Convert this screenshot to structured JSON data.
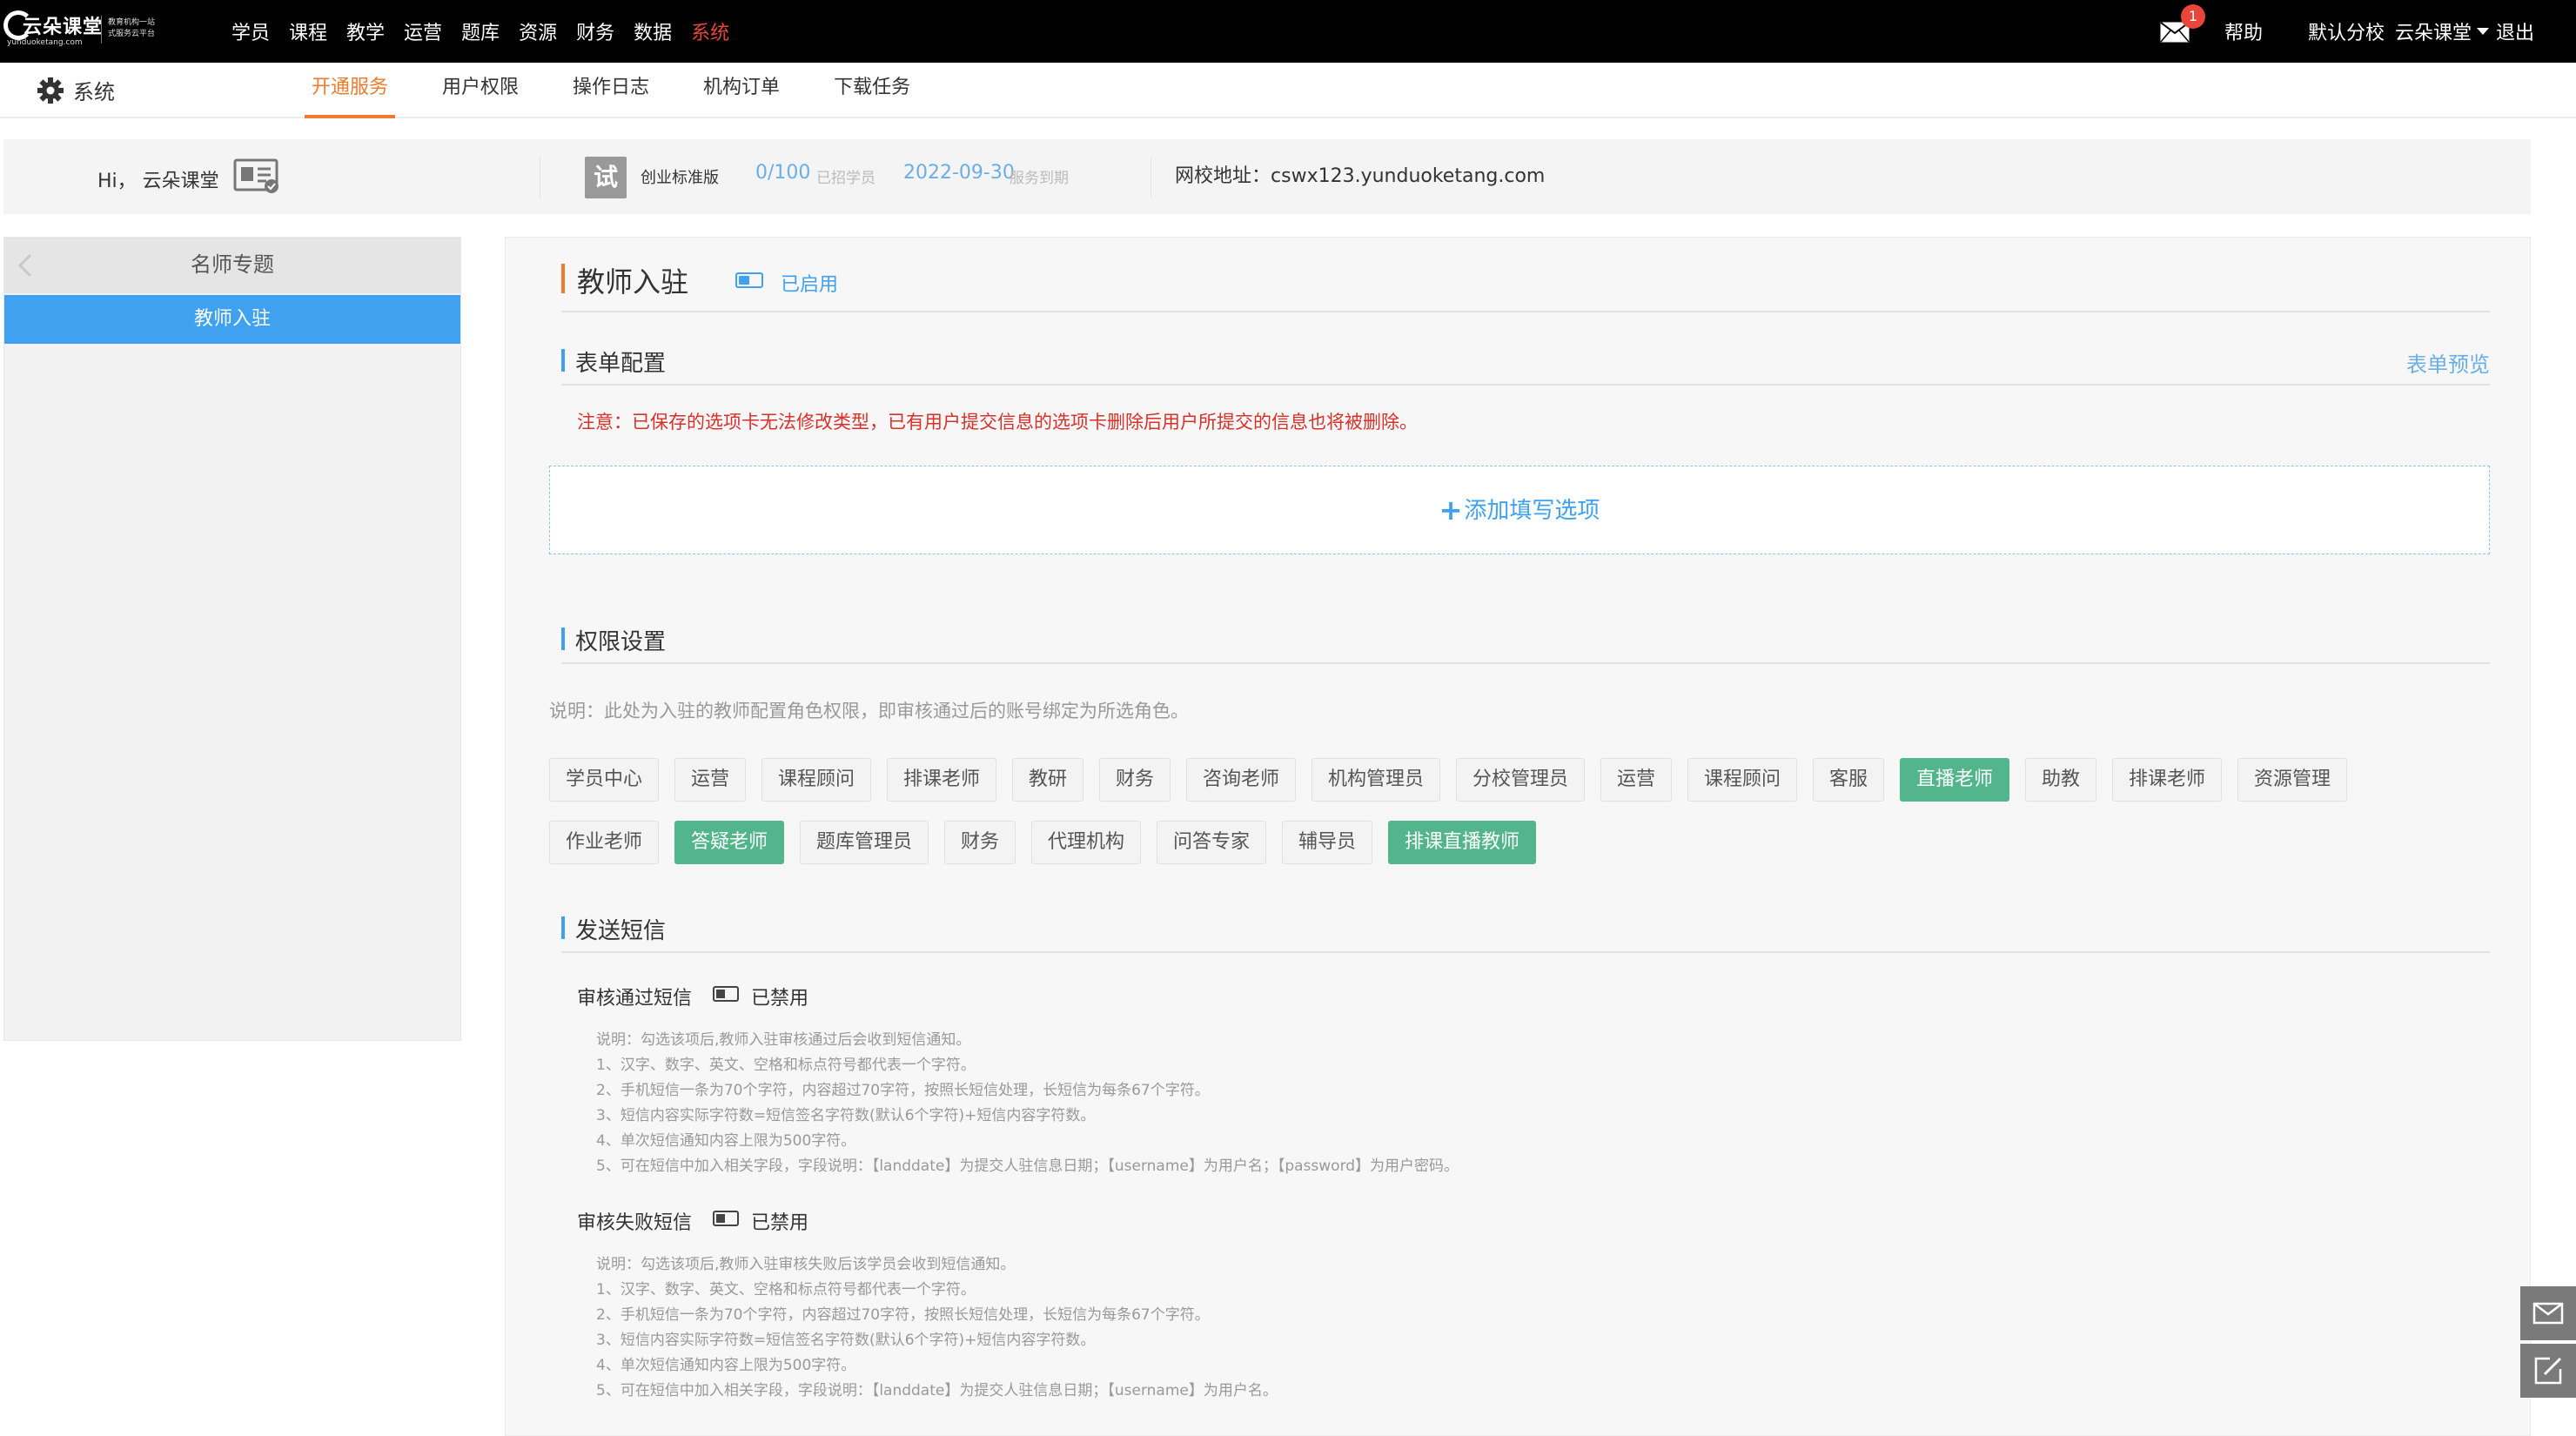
{
  "logo": {
    "name": "云朵课堂",
    "domain": "yunduoketang.com",
    "tagline1": "教育机构一站",
    "tagline2": "式服务云平台"
  },
  "nav": {
    "items": [
      "学员",
      "课程",
      "教学",
      "运营",
      "题库",
      "资源",
      "财务",
      "数据",
      "系统"
    ],
    "active_index": 8
  },
  "topright": {
    "mail_count": "1",
    "help": "帮助",
    "school": "默认分校",
    "user": "云朵课堂",
    "logout": "退出"
  },
  "subnav": {
    "section": "系统",
    "tabs": [
      "开通服务",
      "用户权限",
      "操作日志",
      "机构订单",
      "下载任务"
    ],
    "active_index": 0
  },
  "info": {
    "greeting": "Hi， 云朵课堂",
    "trial_badge": "试",
    "edition": "创业标准版",
    "students_value": "0/100",
    "students_caption": "已招学员",
    "expire_value": "2022-09-30",
    "expire_caption": "服务到期",
    "site_label": "网校地址：",
    "site_url": "cswx123.yunduoketang.com"
  },
  "left": {
    "header": "名师专题",
    "items": [
      "教师入驻"
    ]
  },
  "main": {
    "title": "教师入驻",
    "status": "已启用",
    "form_section": {
      "title": "表单配置",
      "preview_link": "表单预览",
      "notice": "注意：已保存的选项卡无法修改类型，已有用户提交信息的选项卡删除后用户所提交的信息也将被删除。",
      "add_option": "添加填写选项"
    },
    "perm_section": {
      "title": "权限设置",
      "description": "说明：此处为入驻的教师配置角色权限，即审核通过后的账号绑定为所选角色。",
      "roles": [
        {
          "label": "学员中心",
          "selected": false
        },
        {
          "label": "运营",
          "selected": false
        },
        {
          "label": "课程顾问",
          "selected": false
        },
        {
          "label": "排课老师",
          "selected": false
        },
        {
          "label": "教研",
          "selected": false
        },
        {
          "label": "财务",
          "selected": false
        },
        {
          "label": "咨询老师",
          "selected": false
        },
        {
          "label": "机构管理员",
          "selected": false
        },
        {
          "label": "分校管理员",
          "selected": false
        },
        {
          "label": "运营",
          "selected": false
        },
        {
          "label": "课程顾问",
          "selected": false
        },
        {
          "label": "客服",
          "selected": false
        },
        {
          "label": "直播老师",
          "selected": true
        },
        {
          "label": "助教",
          "selected": false
        },
        {
          "label": "排课老师",
          "selected": false
        },
        {
          "label": "资源管理",
          "selected": false
        },
        {
          "label": "作业老师",
          "selected": false
        },
        {
          "label": "答疑老师",
          "selected": true
        },
        {
          "label": "题库管理员",
          "selected": false
        },
        {
          "label": "财务",
          "selected": false
        },
        {
          "label": "代理机构",
          "selected": false
        },
        {
          "label": "问答专家",
          "selected": false
        },
        {
          "label": "辅导员",
          "selected": false
        },
        {
          "label": "排课直播教师",
          "selected": true
        }
      ]
    },
    "sms_section": {
      "title": "发送短信",
      "pass": {
        "label": "审核通过短信",
        "state": "已禁用",
        "notes": [
          "说明：勾选该项后,教师入驻审核通过后会收到短信通知。",
          "1、汉字、数字、英文、空格和标点符号都代表一个字符。",
          "2、手机短信一条为70个字符，内容超过70字符，按照长短信处理，长短信为每条67个字符。",
          "3、短信内容实际字符数=短信签名字符数(默认6个字符)+短信内容字符数。",
          "4、单次短信通知内容上限为500字符。",
          "5、可在短信中加入相关字段，字段说明：【landdate】为提交人驻信息日期；【username】为用户名；【password】为用户密码。"
        ]
      },
      "fail": {
        "label": "审核失败短信",
        "state": "已禁用",
        "notes": [
          "说明：勾选该项后,教师入驻审核失败后该学员会收到短信通知。",
          "1、汉字、数字、英文、空格和标点符号都代表一个字符。",
          "2、手机短信一条为70个字符，内容超过70字符，按照长短信处理，长短信为每条67个字符。",
          "3、短信内容实际字符数=短信签名字符数(默认6个字符)+短信内容字符数。",
          "4、单次短信通知内容上限为500字符。",
          "5、可在短信中加入相关字段，字段说明：【landdate】为提交人驻信息日期；【username】为用户名。"
        ]
      }
    }
  },
  "colors": {
    "accent_blue": "#3fa1f0",
    "accent_orange": "#f07b2c",
    "selected_green": "#52b58b",
    "warning_red": "#d9302a",
    "topbar": "#000000"
  },
  "icons": {
    "mail": "mail-icon",
    "settings": "gear-icon",
    "id_card": "id-card-icon",
    "back": "chevron-left-icon",
    "float_mail": "mail-icon",
    "float_edit": "edit-icon"
  }
}
